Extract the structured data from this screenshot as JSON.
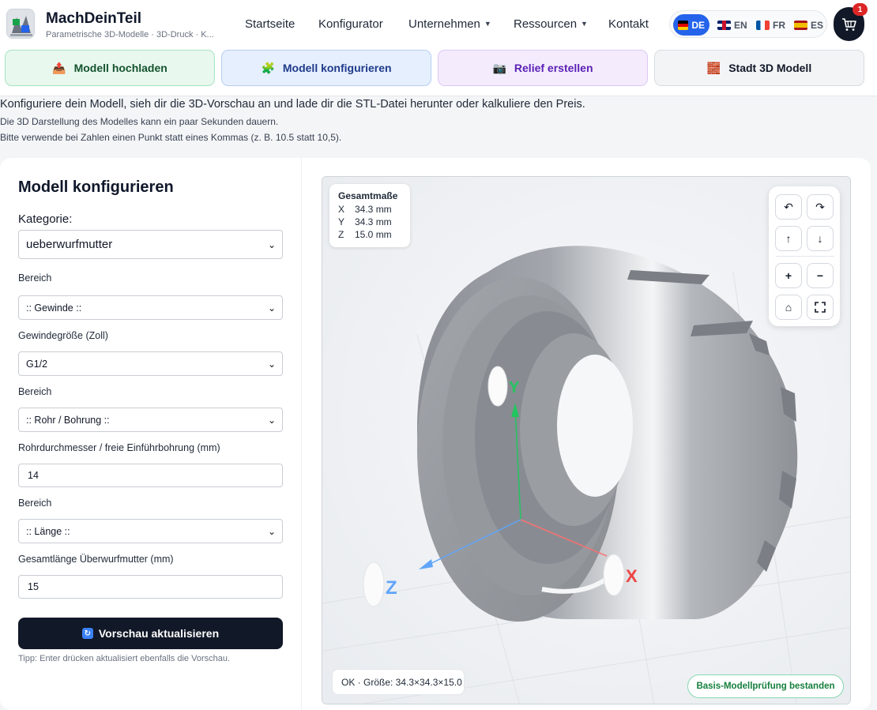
{
  "brand": {
    "title": "MachDeinTeil",
    "subtitle": "Parametrische 3D-Modelle · 3D-Druck · K..."
  },
  "nav": {
    "items": [
      {
        "label": "Startseite",
        "dropdown": false
      },
      {
        "label": "Konfigurator",
        "dropdown": false
      },
      {
        "label": "Unternehmen",
        "dropdown": true
      },
      {
        "label": "Ressourcen",
        "dropdown": true
      },
      {
        "label": "Kontakt",
        "dropdown": false
      }
    ]
  },
  "languages": [
    {
      "code": "DE",
      "flag": "flag-de-icon",
      "active": true
    },
    {
      "code": "EN",
      "flag": "flag-en-icon",
      "active": false
    },
    {
      "code": "FR",
      "flag": "flag-fr-icon",
      "active": false
    },
    {
      "code": "ES",
      "flag": "flag-es-icon",
      "active": false
    }
  ],
  "cart": {
    "count": "1",
    "icon": "cart-icon"
  },
  "tabs": [
    {
      "label": "Modell hochladen",
      "icon": "upload-box-icon",
      "color": "#14532d"
    },
    {
      "label": "Modell konfigurieren",
      "icon": "puzzle-icon",
      "color": "#1e3a8a"
    },
    {
      "label": "Relief erstellen",
      "icon": "camera-icon",
      "color": "#5b21b6"
    },
    {
      "label": "Stadt 3D Modell",
      "icon": "brick-icon",
      "color": "#111827"
    }
  ],
  "intro": {
    "line1": "Konfiguriere dein Modell, sieh dir die 3D-Vorschau an und lade dir die STL-Datei herunter oder kalkuliere den Preis.",
    "line2": "Die 3D Darstellung des Modelles kann ein paar Sekunden dauern.",
    "line3": "Bitte verwende bei Zahlen einen Punkt statt eines Kommas (z. B. 10.5 statt 10,5)."
  },
  "form": {
    "title": "Modell konfigurieren",
    "category_label": "Kategorie:",
    "category_value": "ueberwurfmutter",
    "section1_label": "Bereich",
    "section1_value": ":: Gewinde ::",
    "thread_label": "Gewindegröße (Zoll)",
    "thread_value": "G1/2",
    "section2_label": "Bereich",
    "section2_value": ":: Rohr / Bohrung ::",
    "pipe_label": "Rohrdurchmesser / freie Einführbohrung (mm)",
    "pipe_value": "14",
    "section3_label": "Bereich",
    "section3_value": ":: Länge ::",
    "length_label": "Gesamtlänge Überwurfmutter (mm)",
    "length_value": "15",
    "update_button": "Vorschau aktualisieren",
    "tip": "Tipp: Enter drücken aktualisiert ebenfalls die Vorschau."
  },
  "viewer": {
    "dims_title": "Gesamtmaße",
    "dims": [
      {
        "axis": "X",
        "value": "34.3 mm"
      },
      {
        "axis": "Y",
        "value": "34.3 mm"
      },
      {
        "axis": "Z",
        "value": "15.0 mm"
      }
    ],
    "axis_labels": {
      "x": "X",
      "y": "Y",
      "z": "Z"
    },
    "axis_colors": {
      "x": "#ef4444",
      "y": "#22c55e",
      "z": "#3b82f6"
    },
    "status": "OK · Größe: 34.3×34.3×15.0",
    "check": "Basis-Modellprüfung bestanden",
    "controls": [
      {
        "name": "rotate-left-button",
        "glyph": "↶"
      },
      {
        "name": "rotate-right-button",
        "glyph": "↷"
      },
      {
        "name": "tilt-up-button",
        "glyph": "↑"
      },
      {
        "name": "tilt-down-button",
        "glyph": "↓"
      },
      {
        "name": "zoom-in-button",
        "glyph": "+"
      },
      {
        "name": "zoom-out-button",
        "glyph": "−"
      },
      {
        "name": "home-view-button",
        "glyph": "⌂"
      },
      {
        "name": "fullscreen-button",
        "glyph": "⛶"
      }
    ]
  },
  "colors": {
    "accent": "#2563eb",
    "dark_button": "#111827",
    "success": "#15803d"
  }
}
